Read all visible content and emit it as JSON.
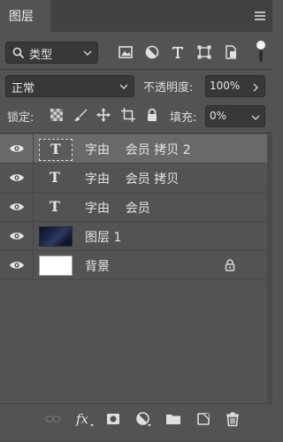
{
  "panel": {
    "tab_label": "图层",
    "menu_icon": "hamburger-menu-icon"
  },
  "filter": {
    "kind_label": "类型",
    "icons": [
      "image-filter-icon",
      "adjustment-filter-icon",
      "type-filter-icon",
      "shape-filter-icon",
      "smart-object-filter-icon"
    ]
  },
  "blend": {
    "mode": "正常",
    "opacity_label": "不透明度:",
    "opacity_value": "100%"
  },
  "lock": {
    "label": "锁定:",
    "fill_label": "填充:",
    "fill_value": "0%",
    "icons": [
      "lock-transparent-pixels-icon",
      "lock-image-pixels-icon",
      "lock-position-icon",
      "lock-artboard-icon",
      "lock-all-icon"
    ]
  },
  "layers": [
    {
      "name": "字由    会员 拷贝 2",
      "kind": "type",
      "selected": true,
      "visible": true
    },
    {
      "name": "字由    会员 拷贝",
      "kind": "type",
      "selected": false,
      "visible": true
    },
    {
      "name": "字由    会员",
      "kind": "type",
      "selected": false,
      "visible": true
    },
    {
      "name": "图层 1",
      "kind": "image",
      "selected": false,
      "visible": true
    },
    {
      "name": "背景",
      "kind": "background",
      "selected": false,
      "visible": true,
      "locked": true
    }
  ],
  "footer": {
    "icons": [
      "link-layers-icon",
      "fx-icon",
      "add-mask-icon",
      "adjustment-layer-icon",
      "new-group-icon",
      "new-layer-icon",
      "trash-icon"
    ]
  },
  "colors": {
    "panel_bg": "#535353",
    "selected_row": "#696969",
    "field_bg": "#383838"
  }
}
